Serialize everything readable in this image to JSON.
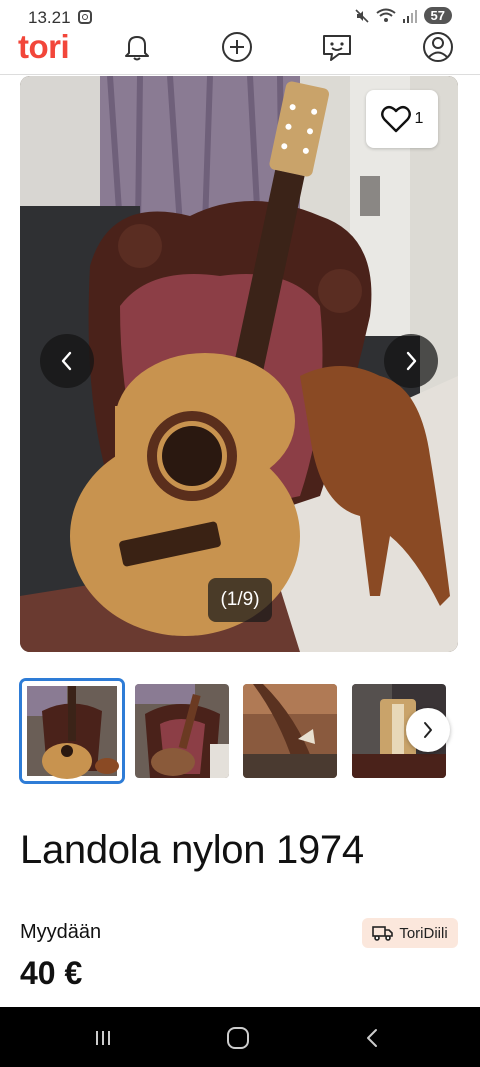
{
  "status_bar": {
    "time": "13.21",
    "battery": "57"
  },
  "header": {
    "logo": "tori",
    "icons": [
      "bell-icon",
      "plus-circle-icon",
      "chat-icon",
      "profile-icon"
    ]
  },
  "gallery": {
    "favorite_count": "1",
    "counter": "(1/9)",
    "thumbnail_count": 4
  },
  "listing": {
    "title": "Landola nylon 1974",
    "trade_type": "Myydään",
    "badge": "ToriDiili",
    "price": "40 €"
  },
  "colors": {
    "brand": "#f2463a",
    "selection": "#2e7cd6",
    "badge_bg": "#fbe7dc"
  }
}
